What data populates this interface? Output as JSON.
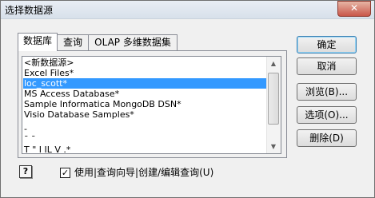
{
  "window": {
    "title": "选择数据源",
    "close_glyph": "✕"
  },
  "tabs": [
    {
      "label": "数据库",
      "active": true
    },
    {
      "label": "查询",
      "active": false
    },
    {
      "label": "OLAP 多维数据集",
      "active": false
    }
  ],
  "list": {
    "items": [
      "<新数据源>",
      "Excel Files*",
      "loc_scott*",
      "MS Access Database*",
      "Sample Informatica MongoDB DSN*",
      "Visio Database Samples*",
      "-",
      "¯ ¯",
      "T                 \"  I  IL  V .*"
    ],
    "selected_index": 2
  },
  "buttons": {
    "ok": "确定",
    "cancel": "取消",
    "browse": "浏览(B)...",
    "options": "选项(O)...",
    "delete": "删除(D)"
  },
  "footer": {
    "help_glyph": "?",
    "checkbox_checked": true,
    "checkbox_mark": "✓",
    "checkbox_label": "使用|查询向导|创建/编辑查询(U)"
  }
}
